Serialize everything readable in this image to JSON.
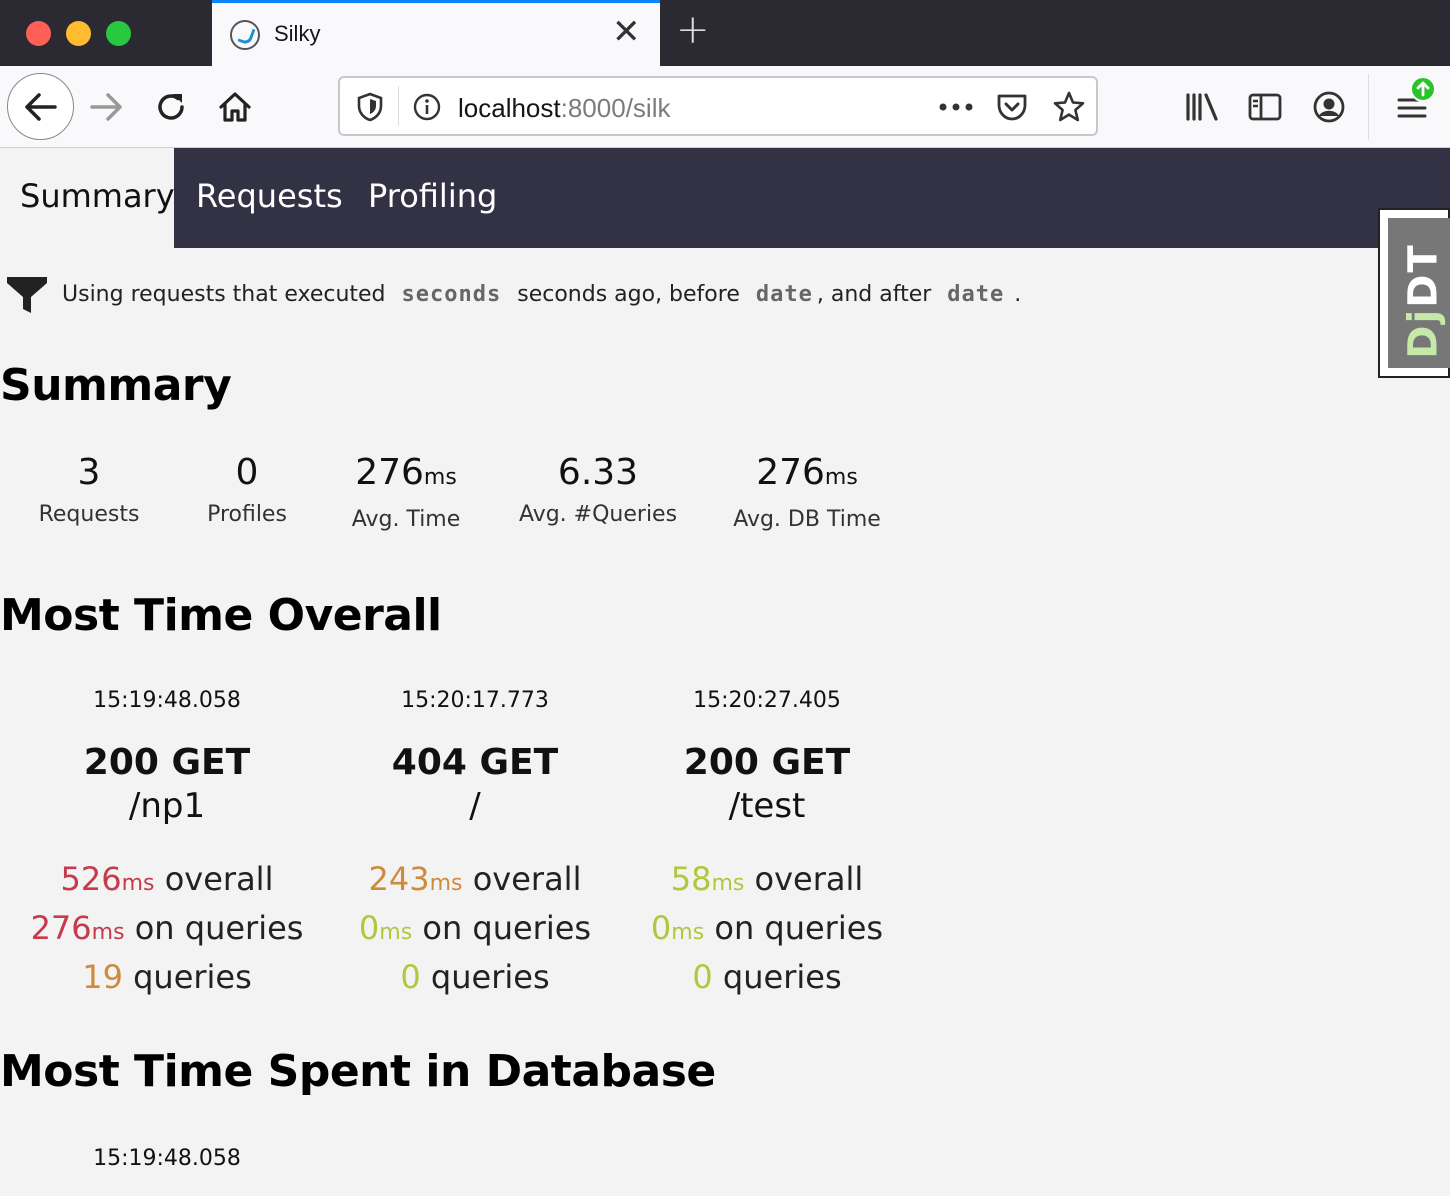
{
  "browser": {
    "tab_title": "Silky",
    "url_host": "localhost",
    "url_path": ":8000/silk",
    "accent_color": "#0a84ff"
  },
  "silk_nav": {
    "tabs": [
      {
        "label": "Summary",
        "active": true
      },
      {
        "label": "Requests",
        "active": false
      },
      {
        "label": "Profiling",
        "active": false
      }
    ]
  },
  "djdt": {
    "prefix": "Dj",
    "suffix": "DT"
  },
  "filter": {
    "part1": "Using requests that executed",
    "kw1": "seconds",
    "part2": "seconds ago, before",
    "kw2": "date",
    "part3": ", and after",
    "kw3": "date",
    "part4": "."
  },
  "summary": {
    "heading": "Summary",
    "stats": [
      {
        "value": "3",
        "unit": "",
        "label": "Requests"
      },
      {
        "value": "0",
        "unit": "",
        "label": "Profiles"
      },
      {
        "value": "276",
        "unit": "ms",
        "label": "Avg. Time"
      },
      {
        "value": "6.33",
        "unit": "",
        "label": "Avg. #Queries"
      },
      {
        "value": "276",
        "unit": "ms",
        "label": "Avg. DB Time"
      }
    ]
  },
  "most_time_overall": {
    "heading": "Most Time Overall",
    "requests": [
      {
        "time": "15:19:48.058",
        "status": "200 GET",
        "path": "/np1",
        "overall": "526",
        "overall_unit": "ms",
        "overall_suffix": "overall",
        "queries_time": "276",
        "queries_unit": "ms",
        "queries_time_suffix": "on queries",
        "num_queries": "19",
        "num_queries_suffix": "queries"
      },
      {
        "time": "15:20:17.773",
        "status": "404 GET",
        "path": "/",
        "overall": "243",
        "overall_unit": "ms",
        "overall_suffix": "overall",
        "queries_time": "0",
        "queries_unit": "ms",
        "queries_time_suffix": "on queries",
        "num_queries": "0",
        "num_queries_suffix": "queries"
      },
      {
        "time": "15:20:27.405",
        "status": "200 GET",
        "path": "/test",
        "overall": "58",
        "overall_unit": "ms",
        "overall_suffix": "overall",
        "queries_time": "0",
        "queries_unit": "ms",
        "queries_time_suffix": "on queries",
        "num_queries": "0",
        "num_queries_suffix": "queries"
      }
    ]
  },
  "most_time_db": {
    "heading": "Most Time Spent in Database",
    "requests": [
      {
        "time": "15:19:48.058"
      }
    ]
  },
  "colors": {
    "slow": "#c53b4c",
    "medium": "#cf8b3c",
    "fast": "#b3c63c",
    "nav_dark": "#333244"
  }
}
